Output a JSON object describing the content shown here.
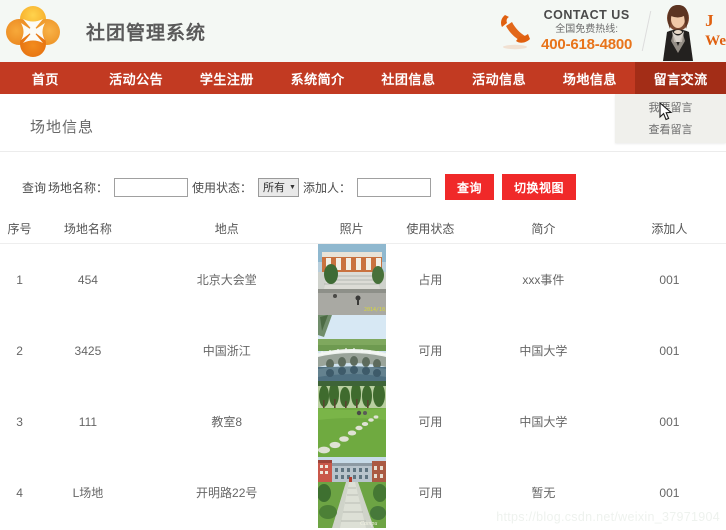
{
  "header": {
    "site_title": "社团管理系统",
    "logo_icon": "flower-logo-icon",
    "phone_icon": "phone-handset-icon",
    "contact_us": "CONTACT US",
    "contact_sub": "全国免费热线:",
    "contact_phone": "400-618-4800",
    "promo_line1": "J",
    "promo_line2": "We",
    "avatar_alt": "avatar-photo",
    "accent_orange": "#e8741a",
    "header_bg": "#f4f8f4"
  },
  "nav": {
    "accent_red": "#c23a22",
    "active_red": "#a32d17",
    "items": [
      {
        "label": "首页",
        "active": false
      },
      {
        "label": "活动公告",
        "active": false
      },
      {
        "label": "学生注册",
        "active": false
      },
      {
        "label": "系统简介",
        "active": false
      },
      {
        "label": "社团信息",
        "active": false
      },
      {
        "label": "活动信息",
        "active": false
      },
      {
        "label": "场地信息",
        "active": false
      },
      {
        "label": "留言交流",
        "active": true
      }
    ],
    "dropdown": {
      "items": [
        {
          "label": "我要留言"
        },
        {
          "label": "查看留言"
        }
      ]
    }
  },
  "main": {
    "page_title": "场地信息",
    "toolbar": {
      "query_label": "查询",
      "name_label": "场地名称：",
      "name_value": "",
      "status_label": "使用状态：",
      "status_value": "所有",
      "status_options": [
        "所有"
      ],
      "adder_label": "添加人：",
      "adder_value": "",
      "search_button": "查询",
      "switch_button": "切换视图",
      "button_color": "#f02929"
    },
    "table": {
      "headers": [
        "序号",
        "场地名称",
        "地点",
        "照片",
        "使用状态",
        "简介",
        "添加人"
      ],
      "rows": [
        {
          "index": "1",
          "name": "454",
          "place": "北京大会堂",
          "photo": "building-steps-photo",
          "status": "占用",
          "desc": "xxx事件",
          "adder": "001"
        },
        {
          "index": "2",
          "name": "3425",
          "place": "中国浙江",
          "photo": "bridge-water-photo",
          "status": "可用",
          "desc": "中国大学",
          "adder": "001"
        },
        {
          "index": "3",
          "name": "111",
          "place": "教室8",
          "photo": "lawn-stones-photo",
          "status": "可用",
          "desc": "中国大学",
          "adder": "001"
        },
        {
          "index": "4",
          "name": "L场地",
          "place": "开明路22号",
          "photo": "campus-path-photo",
          "status": "可用",
          "desc": "暂无",
          "adder": "001"
        }
      ]
    }
  },
  "watermark": {
    "text": "https://blog.csdn.net/weixin_37971904"
  }
}
